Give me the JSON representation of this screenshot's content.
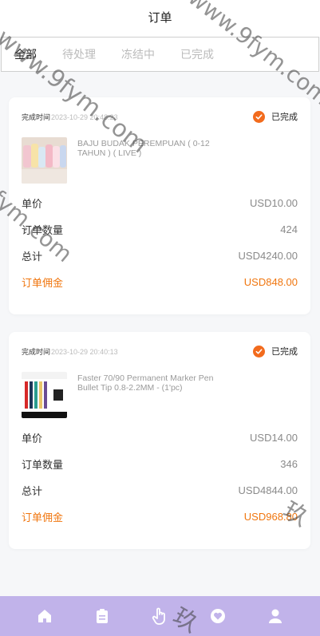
{
  "header": {
    "title": "订单"
  },
  "tabs": [
    {
      "label": "全部",
      "active": true
    },
    {
      "label": "待处理",
      "active": false
    },
    {
      "label": "冻结中",
      "active": false
    },
    {
      "label": "已完成",
      "active": false
    }
  ],
  "orders": [
    {
      "time_label": "完成时间",
      "time": "2023-10-29 20:48:23",
      "status": "已完成",
      "product_name": "BAJU BUDAK PEREMPUAN ( 0-12 TAHUN ) ( LIVE )",
      "price_label": "单价",
      "price": "USD10.00",
      "qty_label": "订单数量",
      "qty": "424",
      "total_label": "总计",
      "total": "USD4240.00",
      "commission_label": "订单佣金",
      "commission": "USD848.00"
    },
    {
      "time_label": "完成时间",
      "time": "2023-10-29 20:40:13",
      "status": "已完成",
      "product_name": "Faster 70/90 Permanent Marker Pen Bullet Tip 0.8-2.2MM - (1'pc)",
      "price_label": "单价",
      "price": "USD14.00",
      "qty_label": "订单数量",
      "qty": "346",
      "total_label": "总计",
      "total": "USD4844.00",
      "commission_label": "订单佣金",
      "commission": "USD968.80"
    }
  ],
  "bottom_nav": {
    "items": [
      "home-icon",
      "clipboard-icon",
      "hand-tap-icon",
      "heart-badge-icon",
      "user-icon"
    ],
    "background": "#c1b3ea"
  },
  "colors": {
    "accent": "#f26b1d",
    "commission": "#f0760f"
  },
  "watermarks": [
    "www.9fym.com",
    "www.9fym.com",
    "9fym.com",
    "玖",
    "玖"
  ]
}
